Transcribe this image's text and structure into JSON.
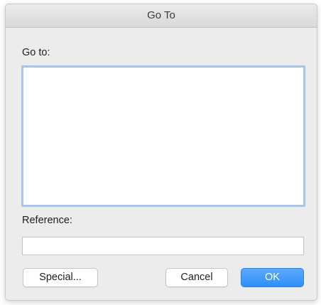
{
  "dialog": {
    "title": "Go To",
    "goto_label": "Go to:",
    "goto_items": [],
    "reference_label": "Reference:",
    "reference_value": ""
  },
  "buttons": {
    "special": "Special...",
    "cancel": "Cancel",
    "ok": "OK"
  },
  "colors": {
    "dialog_background": "#ececec",
    "list_focus_ring": "#a6c4ec",
    "ok_button": "#2d8ff7"
  }
}
